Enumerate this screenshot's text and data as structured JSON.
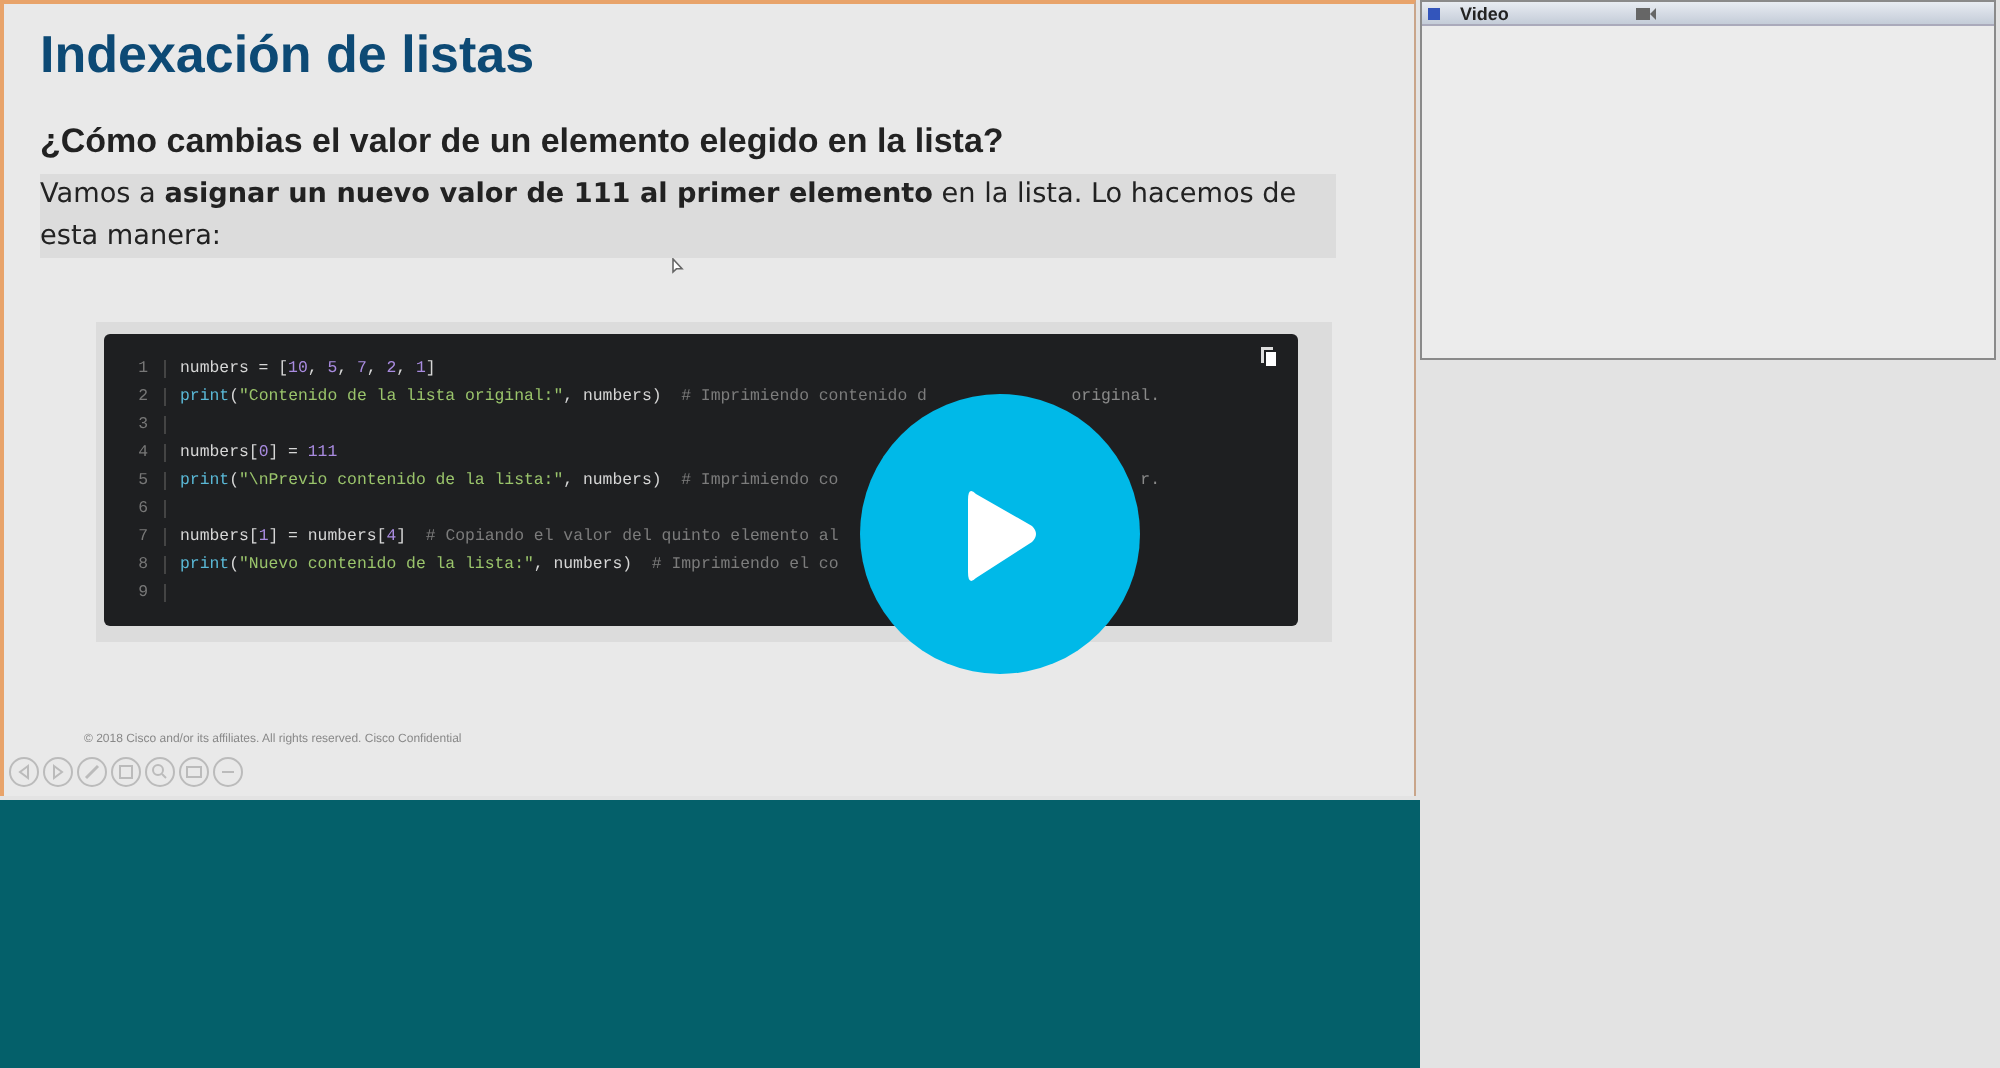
{
  "slide": {
    "title": "Indexación de listas",
    "subtitle": "¿Cómo cambias el valor de un elemento elegido en la lista?",
    "body": "Vamos a **asignar un nuevo valor de 111 al primer elemento** en la lista. Lo hacemos de esta manera:",
    "code": [
      {
        "number": "1",
        "tokens": [
          {
            "kind": "plain",
            "text": "numbers = ["
          },
          {
            "kind": "number",
            "text": "10"
          },
          {
            "kind": "plain",
            "text": ", "
          },
          {
            "kind": "number",
            "text": "5"
          },
          {
            "kind": "plain",
            "text": ", "
          },
          {
            "kind": "number",
            "text": "7"
          },
          {
            "kind": "plain",
            "text": ", "
          },
          {
            "kind": "number",
            "text": "2"
          },
          {
            "kind": "plain",
            "text": ", "
          },
          {
            "kind": "number",
            "text": "1"
          },
          {
            "kind": "plain",
            "text": "]"
          }
        ]
      },
      {
        "number": "2",
        "tokens": [
          {
            "kind": "func",
            "text": "print"
          },
          {
            "kind": "plain",
            "text": "("
          },
          {
            "kind": "string",
            "text": "\"Contenido de la lista original:\""
          },
          {
            "kind": "plain",
            "text": ", numbers)  "
          },
          {
            "kind": "comment",
            "text": "# Imprimiendo contenido d"
          }
        ],
        "tail": "original."
      },
      {
        "number": "3"
      },
      {
        "number": "4",
        "tokens": [
          {
            "kind": "plain",
            "text": "numbers["
          },
          {
            "kind": "number",
            "text": "0"
          },
          {
            "kind": "plain",
            "text": "] = "
          },
          {
            "kind": "number",
            "text": "111"
          }
        ]
      },
      {
        "number": "5",
        "tokens": [
          {
            "kind": "func",
            "text": "print"
          },
          {
            "kind": "plain",
            "text": "("
          },
          {
            "kind": "string",
            "text": "\"\\nPrevio contenido de la lista:\""
          },
          {
            "kind": "plain",
            "text": ", numbers)  "
          },
          {
            "kind": "comment",
            "text": "# Imprimiendo co"
          }
        ],
        "tail": "r."
      },
      {
        "number": "6"
      },
      {
        "number": "7",
        "tokens": [
          {
            "kind": "plain",
            "text": "numbers["
          },
          {
            "kind": "number",
            "text": "1"
          },
          {
            "kind": "plain",
            "text": "] = numbers["
          },
          {
            "kind": "number",
            "text": "4"
          },
          {
            "kind": "plain",
            "text": "]  "
          },
          {
            "kind": "comment",
            "text": "# Copiando el valor del quinto elemento al"
          }
        ]
      },
      {
        "number": "8",
        "tokens": [
          {
            "kind": "func",
            "text": "print"
          },
          {
            "kind": "plain",
            "text": "("
          },
          {
            "kind": "string",
            "text": "\"Nuevo contenido de la lista:\""
          },
          {
            "kind": "plain",
            "text": ", numbers)  "
          },
          {
            "kind": "comment",
            "text": "# Imprimiendo el co"
          }
        ]
      },
      {
        "number": "9"
      }
    ],
    "footer": "© 2018  Cisco and/or its affiliates. All rights reserved.   Cisco Confidential",
    "toolbar": [
      {
        "kind": "prev"
      },
      {
        "kind": "next"
      },
      {
        "kind": "pen"
      },
      {
        "kind": "copy"
      },
      {
        "kind": "zoom"
      },
      {
        "kind": "screen"
      },
      {
        "kind": "more"
      }
    ]
  },
  "video_panel": {
    "title": "Video"
  }
}
